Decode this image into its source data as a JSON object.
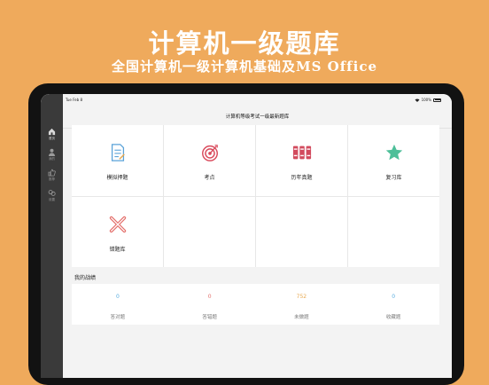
{
  "hero": {
    "title": "计算机一级题库",
    "subtitle": "全国计算机一级计算机基础及MS Office"
  },
  "statusbar": {
    "time": "Tue Feb 8",
    "battery": "100%"
  },
  "sidebar": {
    "items": [
      {
        "label": "首页",
        "icon": "home-icon",
        "active": true
      },
      {
        "label": "我的",
        "icon": "user-icon",
        "active": false
      },
      {
        "label": "推荐",
        "icon": "thumbs-up-icon",
        "active": false
      },
      {
        "label": "设置",
        "icon": "settings-icon",
        "active": false
      }
    ]
  },
  "nav": {
    "title": "计算机等级考试一级最新题库"
  },
  "grid": {
    "items": [
      {
        "label": "模拟押题",
        "icon": "document-icon",
        "color": "#5aa2d8"
      },
      {
        "label": "考点",
        "icon": "target-icon",
        "color": "#d94a5c"
      },
      {
        "label": "历年真题",
        "icon": "books-icon",
        "color": "#d24b5e"
      },
      {
        "label": "复习库",
        "icon": "star-icon",
        "color": "#4dbf99"
      },
      {
        "label": "错题库",
        "icon": "cross-icon",
        "color": "#e4706c"
      }
    ]
  },
  "section": {
    "title": "我的战绩"
  },
  "stats": {
    "items": [
      {
        "value": "0",
        "label": "答对题",
        "color": "#5aaee0"
      },
      {
        "value": "0",
        "label": "答错题",
        "color": "#e4706c"
      },
      {
        "value": "752",
        "label": "未做题",
        "color": "#e8a950"
      },
      {
        "value": "0",
        "label": "收藏题",
        "color": "#5aaee0"
      }
    ]
  },
  "colors": {
    "background": "#efaa5c",
    "sidebar": "#3a3a3a"
  }
}
